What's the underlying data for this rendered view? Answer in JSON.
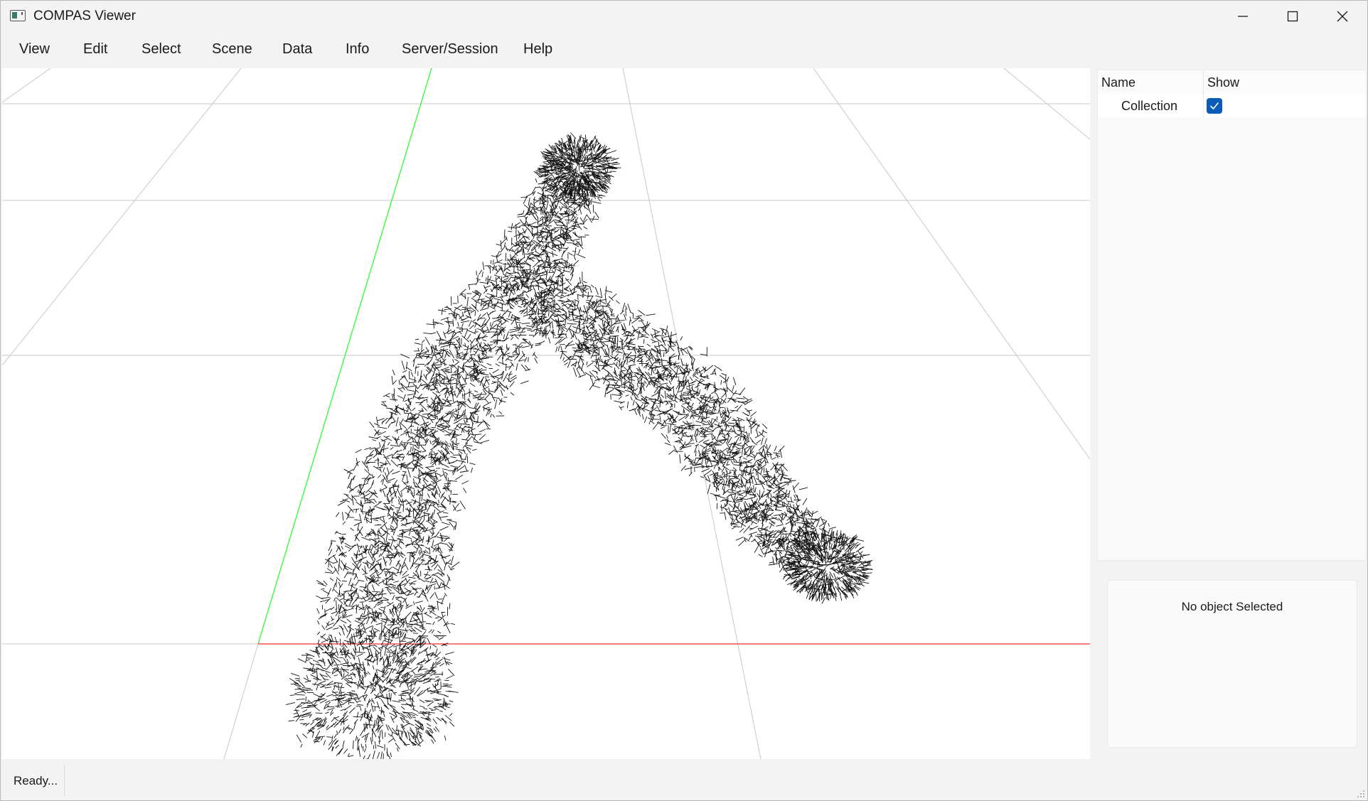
{
  "window": {
    "title": "COMPAS Viewer"
  },
  "menu": [
    {
      "label": "View"
    },
    {
      "label": "Edit"
    },
    {
      "label": "Select"
    },
    {
      "label": "Scene"
    },
    {
      "label": "Data"
    },
    {
      "label": "Info"
    },
    {
      "label": "Server/Session"
    },
    {
      "label": "Help"
    }
  ],
  "scene_tree": {
    "columns": {
      "name": "Name",
      "show": "Show"
    },
    "rows": [
      {
        "name": "Collection",
        "show": true
      }
    ]
  },
  "object_info": {
    "text": "No object Selected"
  },
  "status": {
    "text": "Ready..."
  },
  "viewport": {
    "background": "#ffffff",
    "grid_color": "#c8c8c8",
    "x_axis_color": "#ff2a2a",
    "y_axis_color": "#2bff2b",
    "object_color": "#111111"
  },
  "icons": {
    "app": "app-window-icon",
    "minimize": "minimize-icon",
    "maximize": "maximize-icon",
    "close": "close-icon",
    "checkbox": "checkmark-icon",
    "resize": "resize-grip-icon"
  }
}
